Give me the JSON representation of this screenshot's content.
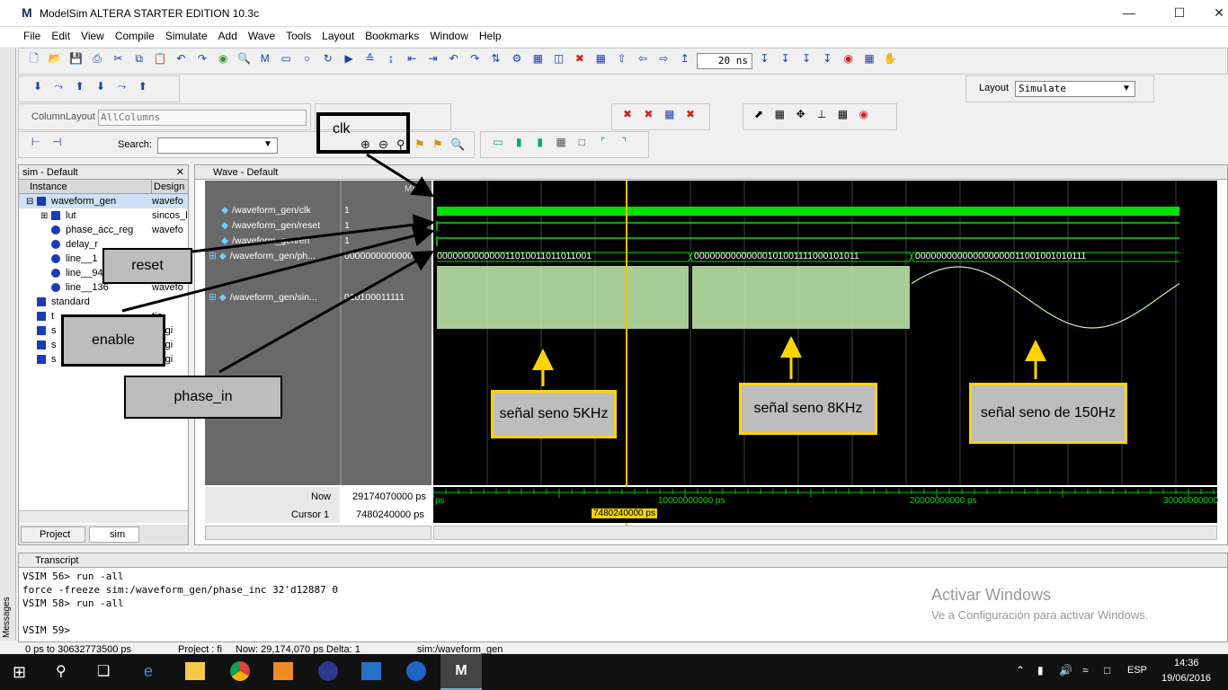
{
  "window": {
    "title": "ModelSim ALTERA STARTER EDITION 10.3c",
    "logo": "M"
  },
  "menu": [
    "File",
    "Edit",
    "View",
    "Compile",
    "Simulate",
    "Add",
    "Wave",
    "Tools",
    "Layout",
    "Bookmarks",
    "Window",
    "Help"
  ],
  "toolbar": {
    "runtime_value": "20 ns",
    "layout_label": "Layout",
    "layout_value": "Simulate",
    "column_layout_label": "ColumnLayout",
    "column_layout_value": "AllColumns",
    "search_label": "Search:",
    "search_value": ""
  },
  "sim_pane": {
    "title": "sim - Default",
    "columns": [
      "Instance",
      "Design"
    ],
    "rows": [
      {
        "name": "waveform_gen",
        "design": "wavefo",
        "type": "sq",
        "indent": 0,
        "expand": "-"
      },
      {
        "name": "lut",
        "design": "sincos_l",
        "type": "sq",
        "indent": 1,
        "expand": "+"
      },
      {
        "name": "phase_acc_reg",
        "design": "wavefo",
        "type": "ci",
        "indent": 1,
        "expand": ""
      },
      {
        "name": "delay_r",
        "design": "",
        "type": "ci",
        "indent": 1,
        "expand": ""
      },
      {
        "name": "line__1",
        "design": "",
        "type": "ci",
        "indent": 1,
        "expand": ""
      },
      {
        "name": "line__94",
        "design": "",
        "type": "ci",
        "indent": 1,
        "expand": ""
      },
      {
        "name": "line__136",
        "design": "wavefo",
        "type": "ci",
        "indent": 1,
        "expand": ""
      },
      {
        "name": "standard",
        "design": "",
        "type": "sq",
        "indent": 0,
        "expand": ""
      },
      {
        "name": "t",
        "design": "tio",
        "type": "sq",
        "indent": 0,
        "expand": ""
      },
      {
        "name": "s",
        "design": "_logi",
        "type": "sq",
        "indent": 0,
        "expand": ""
      },
      {
        "name": "s",
        "design": "_logi",
        "type": "sq",
        "indent": 0,
        "expand": ""
      },
      {
        "name": "s",
        "design": "_logi",
        "type": "sq",
        "indent": 0,
        "expand": ""
      }
    ],
    "tabs": [
      "Project",
      "sim"
    ]
  },
  "wave_pane": {
    "title": "Wave - Default",
    "msgs_header": "Msgs",
    "signals": [
      {
        "name": "/waveform_gen/clk",
        "value": "1"
      },
      {
        "name": "/waveform_gen/reset",
        "value": "1"
      },
      {
        "name": "/waveform_gen/en",
        "value": "1"
      },
      {
        "name": "/waveform_gen/ph...",
        "value": "0000000000000"
      },
      {
        "name": "/waveform_gen/sin...",
        "value": "010100011111"
      }
    ],
    "bus_values": [
      "000000000000011010011011011001",
      "00000000000000101001111000101011",
      "000000000000000000011001001010111"
    ],
    "now_label": "Now",
    "now_value": "29174070000 ps",
    "cursor_label": "Cursor 1",
    "cursor_value": "7480240000 ps",
    "cursor_tag": "7480240000 ps",
    "time_labels": [
      "ps",
      "10000000000 ps",
      "20000000000 ps",
      "30000000000"
    ]
  },
  "annotations": {
    "clk": "clk",
    "reset": "reset",
    "enable": "enable",
    "phase_in": "phase_in",
    "sine1": "señal seno 5KHz",
    "sine2": "señal seno 8KHz",
    "sine3": "señal seno de 150Hz"
  },
  "transcript": {
    "title": "Transcript",
    "side_label": "Messages",
    "lines": [
      "VSIM 56> run -all",
      "force -freeze sim:/waveform_gen/phase_inc 32'd12887 0",
      "VSIM 58> run -all",
      "",
      "VSIM 59>"
    ]
  },
  "watermark": {
    "line1": "Activar Windows",
    "line2": "Ve a Configuración para activar Windows."
  },
  "statusbar": {
    "range": "0 ps to 30632773500 ps",
    "project": "Project : fi",
    "now": "Now: 29,174,070 ps  Delta: 1",
    "scope": "sim:/waveform_gen"
  },
  "taskbar": {
    "lang": "ESP",
    "time": "14:36",
    "date": "19/06/2016"
  }
}
